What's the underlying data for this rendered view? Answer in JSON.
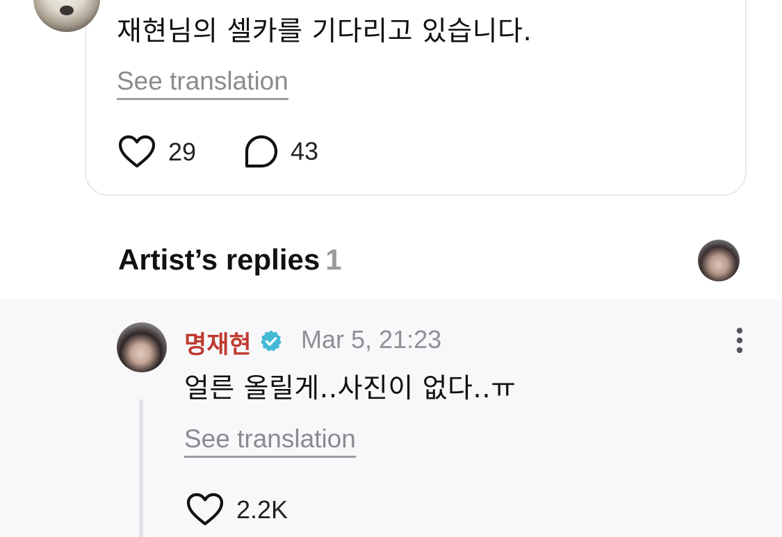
{
  "post": {
    "text": "재현님의 셀카를 기다리고 있습니다.",
    "see_translation": "See translation",
    "likes": "29",
    "comments": "43"
  },
  "replies_header": {
    "title": "Artist’s replies",
    "count": "1"
  },
  "reply": {
    "author": "명재현",
    "timestamp": "Mar 5, 21:23",
    "text": "얼른 올릴게..사진이 없다..ㅠ",
    "see_translation": "See translation",
    "likes": "2.2K"
  },
  "colors": {
    "author_name": "#c0392f",
    "verified_badge": "#43b9d6",
    "muted_text": "#8f8f94",
    "reply_background": "#f8f8fb",
    "card_border": "#e9e9ec"
  },
  "icons": {
    "like": "heart-outline-icon",
    "comment": "speech-bubble-icon",
    "verified": "verified-badge-icon",
    "more": "more-vertical-icon"
  }
}
